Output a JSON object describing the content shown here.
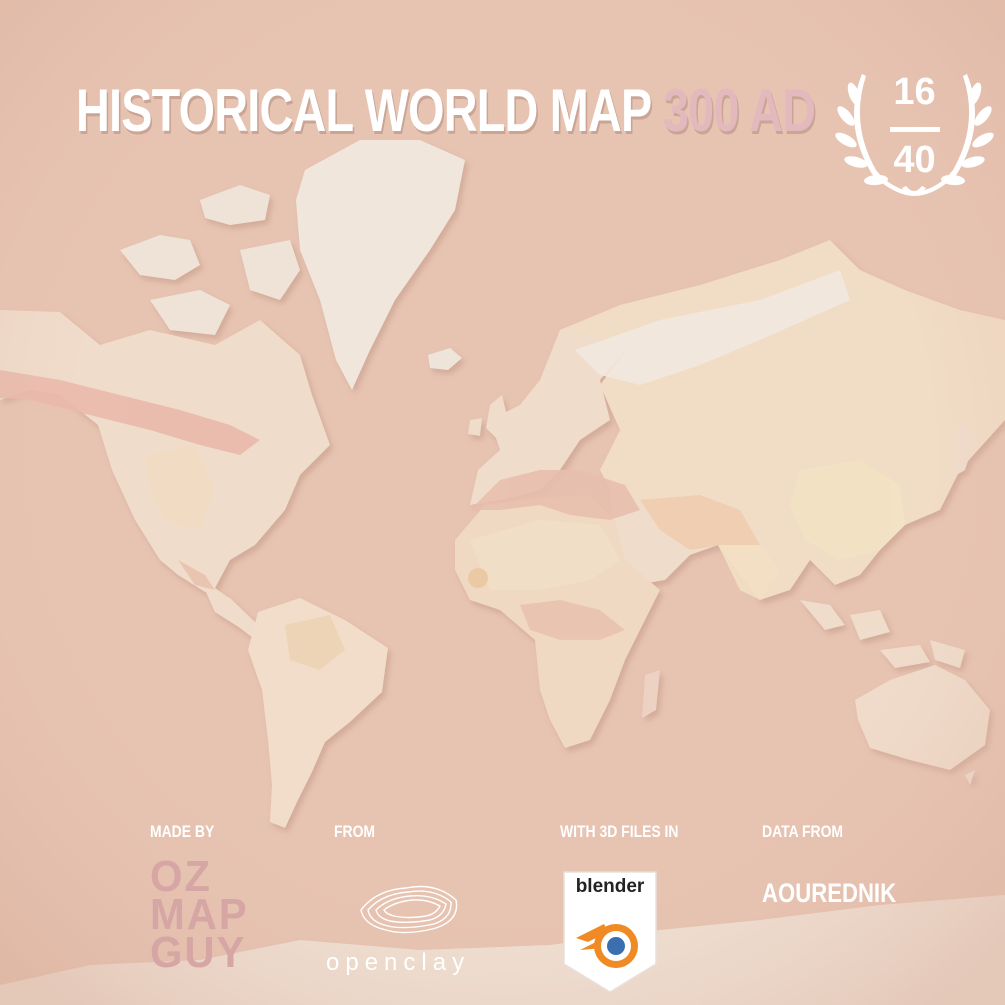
{
  "title": {
    "main": "HISTORICAL WORLD MAP",
    "year": "300 AD"
  },
  "badge": {
    "current": "16",
    "total": "40"
  },
  "credits": {
    "made_by_label": "MADE BY",
    "made_by_lines": [
      "OZ",
      "MAP",
      "GUY"
    ],
    "from_label": "FROM",
    "from_name": "openclay",
    "files_label": "WITH 3D FILES IN",
    "files_name": "blender",
    "data_label": "DATA FROM",
    "data_name": "AOUREDNIK"
  },
  "colors": {
    "ocean": "#e7c3b1",
    "land": "#f1ddc9",
    "ice": "#efe2d6",
    "roman_empire": "#e9c4b4",
    "persian_empire": "#efd0b5",
    "han_empire": "#f3e0c3",
    "eurasian_steppe": "#f2dcc4",
    "title_year": "#e3b9bd",
    "oz_map_guy": "#d6a6a4"
  },
  "icons": [
    "laurel-wreath-icon",
    "opencloy-logo-icon",
    "blender-logo-icon"
  ]
}
